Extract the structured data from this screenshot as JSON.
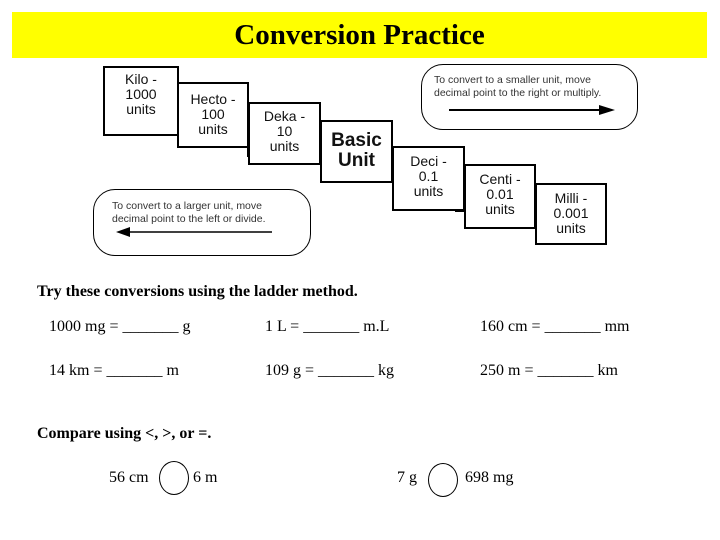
{
  "title": "Conversion Practice",
  "ladder": {
    "steps": [
      {
        "prefix": "Kilo -",
        "value": "1000",
        "unit": "units"
      },
      {
        "prefix": "Hecto -",
        "value": "100",
        "unit": "units"
      },
      {
        "prefix": "Deka -",
        "value": "10",
        "unit": "units"
      },
      {
        "prefix": "Basic",
        "value": "Unit",
        "unit": ""
      },
      {
        "prefix": "Deci -",
        "value": "0.1",
        "unit": "units"
      },
      {
        "prefix": "Centi -",
        "value": "0.01",
        "unit": "units"
      },
      {
        "prefix": "Milli -",
        "value": "0.001",
        "unit": "units"
      }
    ],
    "callout_smaller": {
      "line1": "To convert to a smaller unit, move",
      "line2": "decimal  point to the right or multiply.",
      "arrow_direction": "right"
    },
    "callout_larger": {
      "line1": "To convert to a larger unit, move",
      "line2": "decimal  point to the left or divide.",
      "arrow_direction": "left"
    }
  },
  "conversions": {
    "heading": "Try these conversions using the ladder method.",
    "problems": [
      {
        "text": "1000 mg = _______ g"
      },
      {
        "text": "1 L = _______ m.L"
      },
      {
        "text": "160 cm = _______ mm"
      },
      {
        "text": "14 km = _______ m"
      },
      {
        "text": "109 g = _______ kg"
      },
      {
        "text": "250 m = _______ km"
      }
    ]
  },
  "compare": {
    "heading": "Compare using <, >, or =.",
    "items": [
      {
        "left": "56 cm",
        "right": "6 m"
      },
      {
        "left": "7 g",
        "right": "698 mg"
      }
    ]
  }
}
